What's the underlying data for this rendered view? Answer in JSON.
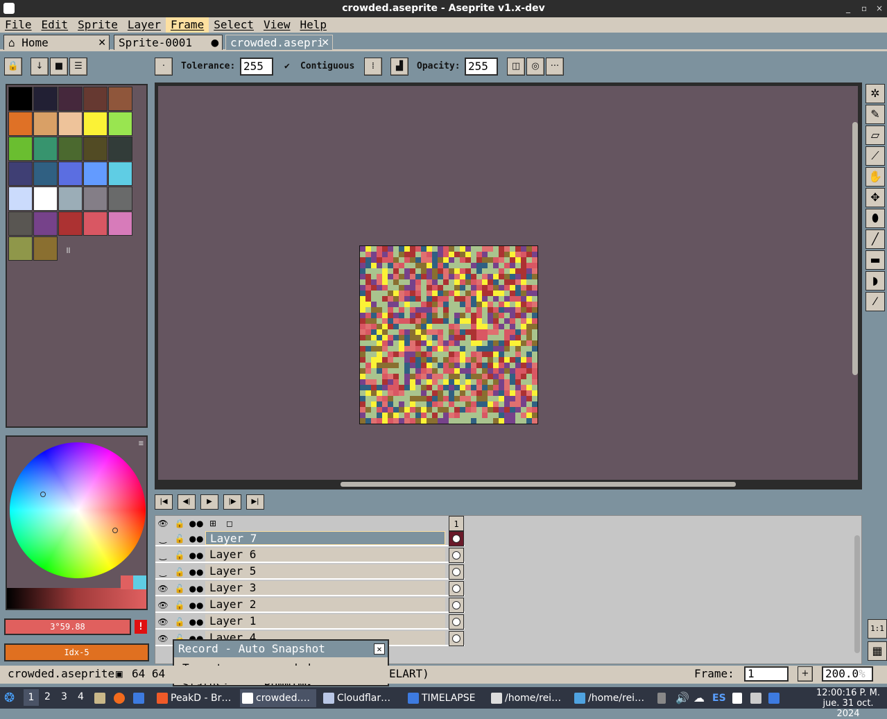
{
  "window": {
    "title": "crowded.aseprite - Aseprite v1.x-dev",
    "controls": [
      "_",
      "▫",
      "×"
    ]
  },
  "menu": [
    "File",
    "Edit",
    "Sprite",
    "Layer",
    "Frame",
    "Select",
    "View",
    "Help"
  ],
  "menu_active": "Frame",
  "tabs": {
    "home": "Home",
    "sprite1": "Sprite-0001",
    "active": "crowded.asepri"
  },
  "context_bar": {
    "tolerance_label": "Tolerance:",
    "tolerance_value": "255",
    "contiguous_label": "Contiguous",
    "opacity_label": "Opacity:",
    "opacity_value": "255",
    "more": "···"
  },
  "palette": {
    "colors": [
      "#000000",
      "#222034",
      "#45283c",
      "#663931",
      "#8f563b",
      "#df7126",
      "#d9a066",
      "#eec39a",
      "#fbf236",
      "#99e550",
      "#6abe30",
      "#37946e",
      "#4b692f",
      "#524b24",
      "#323c39",
      "#3f3f74",
      "#306082",
      "#5b6ee1",
      "#639bff",
      "#5fcde4",
      "#cbdbfc",
      "#ffffff",
      "#9badb7",
      "#847e87",
      "#696a6a",
      "#595652",
      "#76428a",
      "#ac3232",
      "#d95763",
      "#d77bba",
      "#8f974a",
      "#8a6f30"
    ],
    "drag_handle": "॥"
  },
  "color": {
    "fg_text": "3°59.88",
    "bg_text": "Idx-5",
    "alert": "!"
  },
  "timeline": {
    "frame_header": "1",
    "layers": [
      {
        "name": "Layer 7",
        "visible": false,
        "selected": true
      },
      {
        "name": "Layer 6",
        "visible": false,
        "selected": false
      },
      {
        "name": "Layer 5",
        "visible": false,
        "selected": false
      },
      {
        "name": "Layer 3",
        "visible": true,
        "selected": false
      },
      {
        "name": "Layer 2",
        "visible": true,
        "selected": false
      },
      {
        "name": "Layer 1",
        "visible": true,
        "selected": false
      },
      {
        "name": "Layer 4",
        "visible": true,
        "selected": false
      }
    ]
  },
  "popup": {
    "title": "Record - Auto Snapshot",
    "target_label": "Target:",
    "target_value": "crowded",
    "status_label": "Status:",
    "status_value": "RUNNING"
  },
  "status": {
    "file": "crowded.aseprite",
    "size": "64 64",
    "hidden_text": "ELART)",
    "frame_label": "Frame:",
    "frame_value": "1",
    "add": "+",
    "zoom": "200.0",
    "zoom_unit": "%"
  },
  "side_buttons": {
    "one_to_one": "1:1"
  },
  "taskbar": {
    "workspaces": [
      "1",
      "2",
      "3",
      "4"
    ],
    "tasks": [
      "PeakD - Br…",
      "crowded.…",
      "Cloudflar…",
      "TIMELAPSE",
      "/home/rei…",
      "/home/rei…"
    ],
    "lang": "ES",
    "time": "12:00:16 P. M.",
    "date": "jue. 31 oct. 2024"
  },
  "colors": {
    "bg": "#7d929e",
    "panel": "#d3cbbe",
    "canvas": "#655560",
    "highlight": "#fde0a0"
  }
}
